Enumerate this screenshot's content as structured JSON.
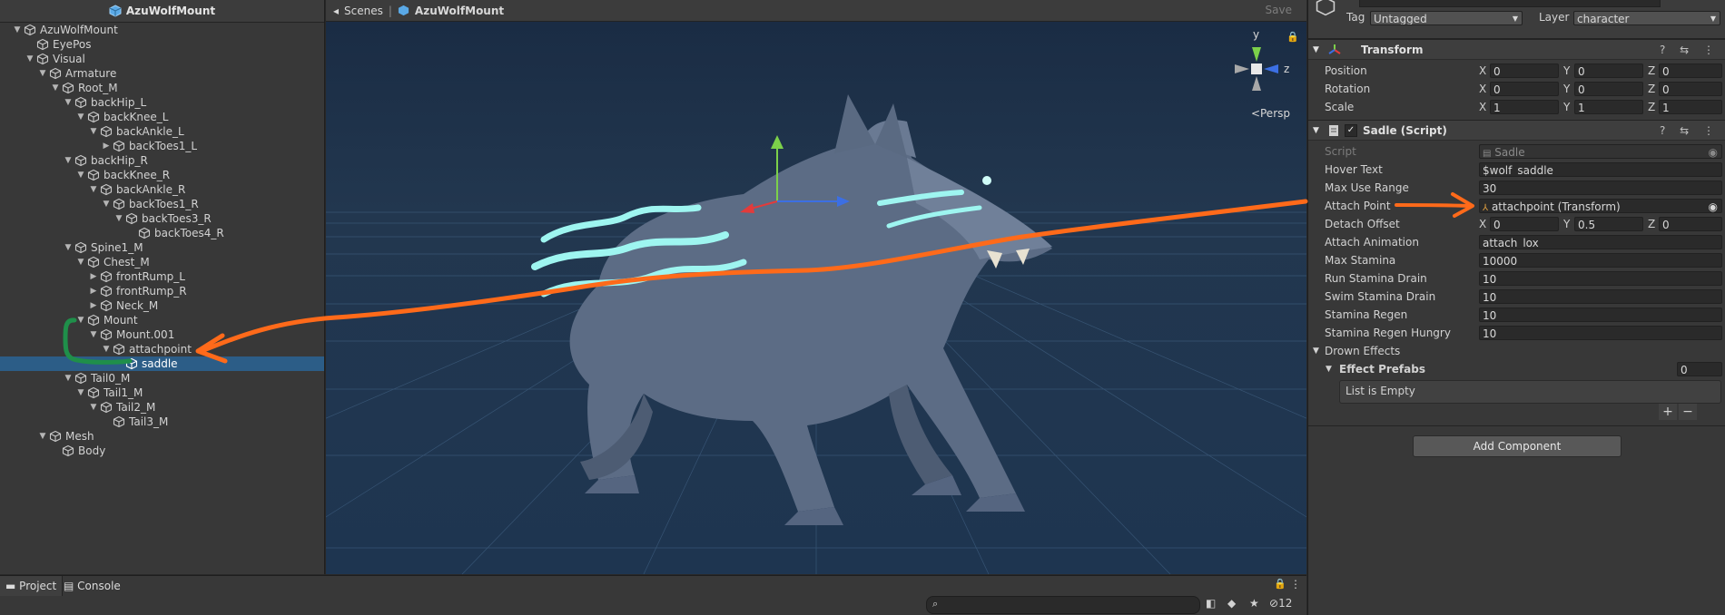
{
  "hierarchy": {
    "title": "AzuWolfMount",
    "rows": [
      {
        "label": "AzuWolfMount",
        "depth": 0,
        "expanded": true
      },
      {
        "label": "EyePos",
        "depth": 1,
        "expanded": null
      },
      {
        "label": "Visual",
        "depth": 1,
        "expanded": true
      },
      {
        "label": "Armature",
        "depth": 2,
        "expanded": true
      },
      {
        "label": "Root_M",
        "depth": 3,
        "expanded": true
      },
      {
        "label": "backHip_L",
        "depth": 4,
        "expanded": true
      },
      {
        "label": "backKnee_L",
        "depth": 5,
        "expanded": true
      },
      {
        "label": "backAnkle_L",
        "depth": 6,
        "expanded": true
      },
      {
        "label": "backToes1_L",
        "depth": 7,
        "expanded": false
      },
      {
        "label": "backHip_R",
        "depth": 4,
        "expanded": true
      },
      {
        "label": "backKnee_R",
        "depth": 5,
        "expanded": true
      },
      {
        "label": "backAnkle_R",
        "depth": 6,
        "expanded": true
      },
      {
        "label": "backToes1_R",
        "depth": 7,
        "expanded": true
      },
      {
        "label": "backToes3_R",
        "depth": 8,
        "expanded": true
      },
      {
        "label": "backToes4_R",
        "depth": 9,
        "expanded": null
      },
      {
        "label": "Spine1_M",
        "depth": 4,
        "expanded": true
      },
      {
        "label": "Chest_M",
        "depth": 5,
        "expanded": true
      },
      {
        "label": "frontRump_L",
        "depth": 6,
        "expanded": false
      },
      {
        "label": "frontRump_R",
        "depth": 6,
        "expanded": false
      },
      {
        "label": "Neck_M",
        "depth": 6,
        "expanded": false
      },
      {
        "label": "Mount",
        "depth": 5,
        "expanded": true
      },
      {
        "label": "Mount.001",
        "depth": 6,
        "expanded": true
      },
      {
        "label": "attachpoint",
        "depth": 7,
        "expanded": true
      },
      {
        "label": "saddle",
        "depth": 8,
        "expanded": null,
        "selected": true
      },
      {
        "label": "Tail0_M",
        "depth": 4,
        "expanded": true
      },
      {
        "label": "Tail1_M",
        "depth": 5,
        "expanded": true
      },
      {
        "label": "Tail2_M",
        "depth": 6,
        "expanded": true
      },
      {
        "label": "Tail3_M",
        "depth": 7,
        "expanded": null
      },
      {
        "label": "Mesh",
        "depth": 2,
        "expanded": true
      },
      {
        "label": "Body",
        "depth": 3,
        "expanded": null
      }
    ]
  },
  "scene": {
    "tab_label": "Scenes",
    "breadcrumb": "AzuWolfMount",
    "save_label": "Save",
    "persp_label": "Persp",
    "gizmo_y": "y",
    "gizmo_z": "z"
  },
  "inspector": {
    "tag_label": "Tag",
    "tag_value": "Untagged",
    "layer_label": "Layer",
    "layer_value": "character",
    "transform": {
      "title": "Transform",
      "rows": [
        {
          "label": "Position",
          "x": "0",
          "y": "0",
          "z": "0"
        },
        {
          "label": "Rotation",
          "x": "0",
          "y": "0",
          "z": "0"
        },
        {
          "label": "Scale",
          "x": "1",
          "y": "1",
          "z": "1"
        }
      ]
    },
    "sadle": {
      "title": "Sadle (Script)",
      "script_label": "Script",
      "script_value": "Sadle",
      "hover_text_label": "Hover Text",
      "hover_text_value": "$wolf_saddle",
      "max_use_range_label": "Max Use Range",
      "max_use_range_value": "30",
      "attach_point_label": "Attach Point",
      "attach_point_value": "attachpoint (Transform)",
      "detach_offset_label": "Detach Offset",
      "detach_offset": {
        "x": "0",
        "y": "0.5",
        "z": "0"
      },
      "attach_animation_label": "Attach Animation",
      "attach_animation_value": "attach_lox",
      "max_stamina_label": "Max Stamina",
      "max_stamina_value": "10000",
      "run_stamina_drain_label": "Run Stamina Drain",
      "run_stamina_drain_value": "10",
      "swim_stamina_drain_label": "Swim Stamina Drain",
      "swim_stamina_drain_value": "10",
      "stamina_regen_label": "Stamina Regen",
      "stamina_regen_value": "10",
      "stamina_regen_hungry_label": "Stamina Regen Hungry",
      "stamina_regen_hungry_value": "10",
      "drown_effects_label": "Drown Effects",
      "effect_prefabs_label": "Effect Prefabs",
      "effect_prefabs_count": "0",
      "list_empty_label": "List is Empty",
      "plus": "+",
      "minus": "−"
    },
    "add_component_label": "Add Component"
  },
  "bottom": {
    "project_tab": "Project",
    "console_tab": "Console",
    "hidden_count": "12"
  },
  "colors": {
    "selection": "#2c5d87",
    "annotation_orange": "#ff6a1a",
    "annotation_green": "#1f8f4a",
    "wolf_glow": "#9ef5f0"
  }
}
